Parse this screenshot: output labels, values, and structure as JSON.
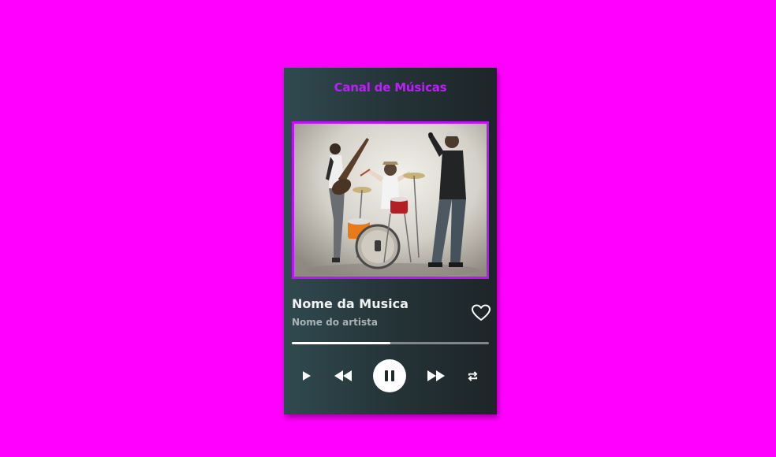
{
  "player": {
    "title": "Canal de Músicas",
    "song_name": "Nome da Musica",
    "artist_name": "Nome do artista",
    "progress_fraction": 0.5,
    "accent_color": "#c11cff",
    "background_color": "#ff00ff"
  },
  "icons": {
    "favorite": "heart-outline-icon",
    "play": "play-icon",
    "previous": "rewind-icon",
    "pause": "pause-icon",
    "next": "fast-forward-icon",
    "repeat": "repeat-icon"
  }
}
